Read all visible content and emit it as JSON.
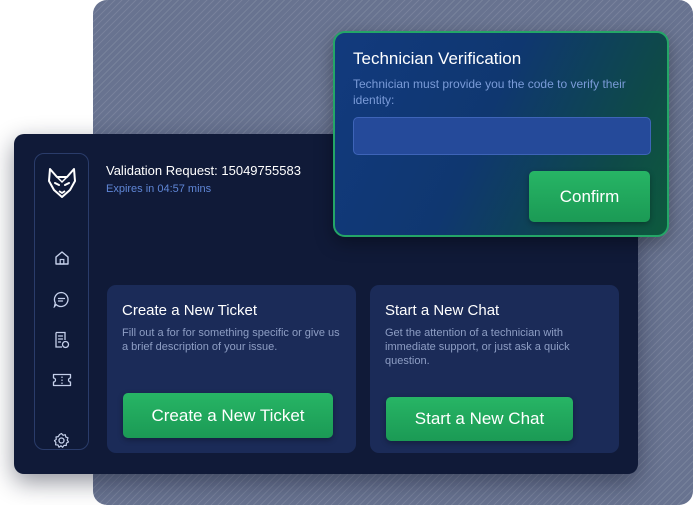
{
  "validation": {
    "title": "Validation Request: 15049755583",
    "expires": "Expires in 04:57 mins"
  },
  "sidebar": {
    "items": [
      {
        "icon": "wolf-logo-icon"
      },
      {
        "icon": "home-icon"
      },
      {
        "icon": "chat-icon"
      },
      {
        "icon": "ticket-list-icon"
      },
      {
        "icon": "ticket-icon"
      },
      {
        "icon": "gear-icon"
      }
    ]
  },
  "cards": {
    "ticket": {
      "title": "Create a New Ticket",
      "description": "Fill out a for for something specific or give us a brief description of your issue.",
      "button": "Create a New Ticket"
    },
    "chat": {
      "title": "Start a New Chat",
      "description": "Get the attention of a technician with immediate support, or just ask a quick question.",
      "button": "Start a New Chat"
    }
  },
  "verification": {
    "title": "Technician Verification",
    "description": "Technician must provide you the code to verify their identity:",
    "input_value": "",
    "confirm_label": "Confirm"
  },
  "colors": {
    "accent_green": "#1fa85c",
    "window_bg": "#101a38",
    "card_bg": "#1b2b58"
  }
}
